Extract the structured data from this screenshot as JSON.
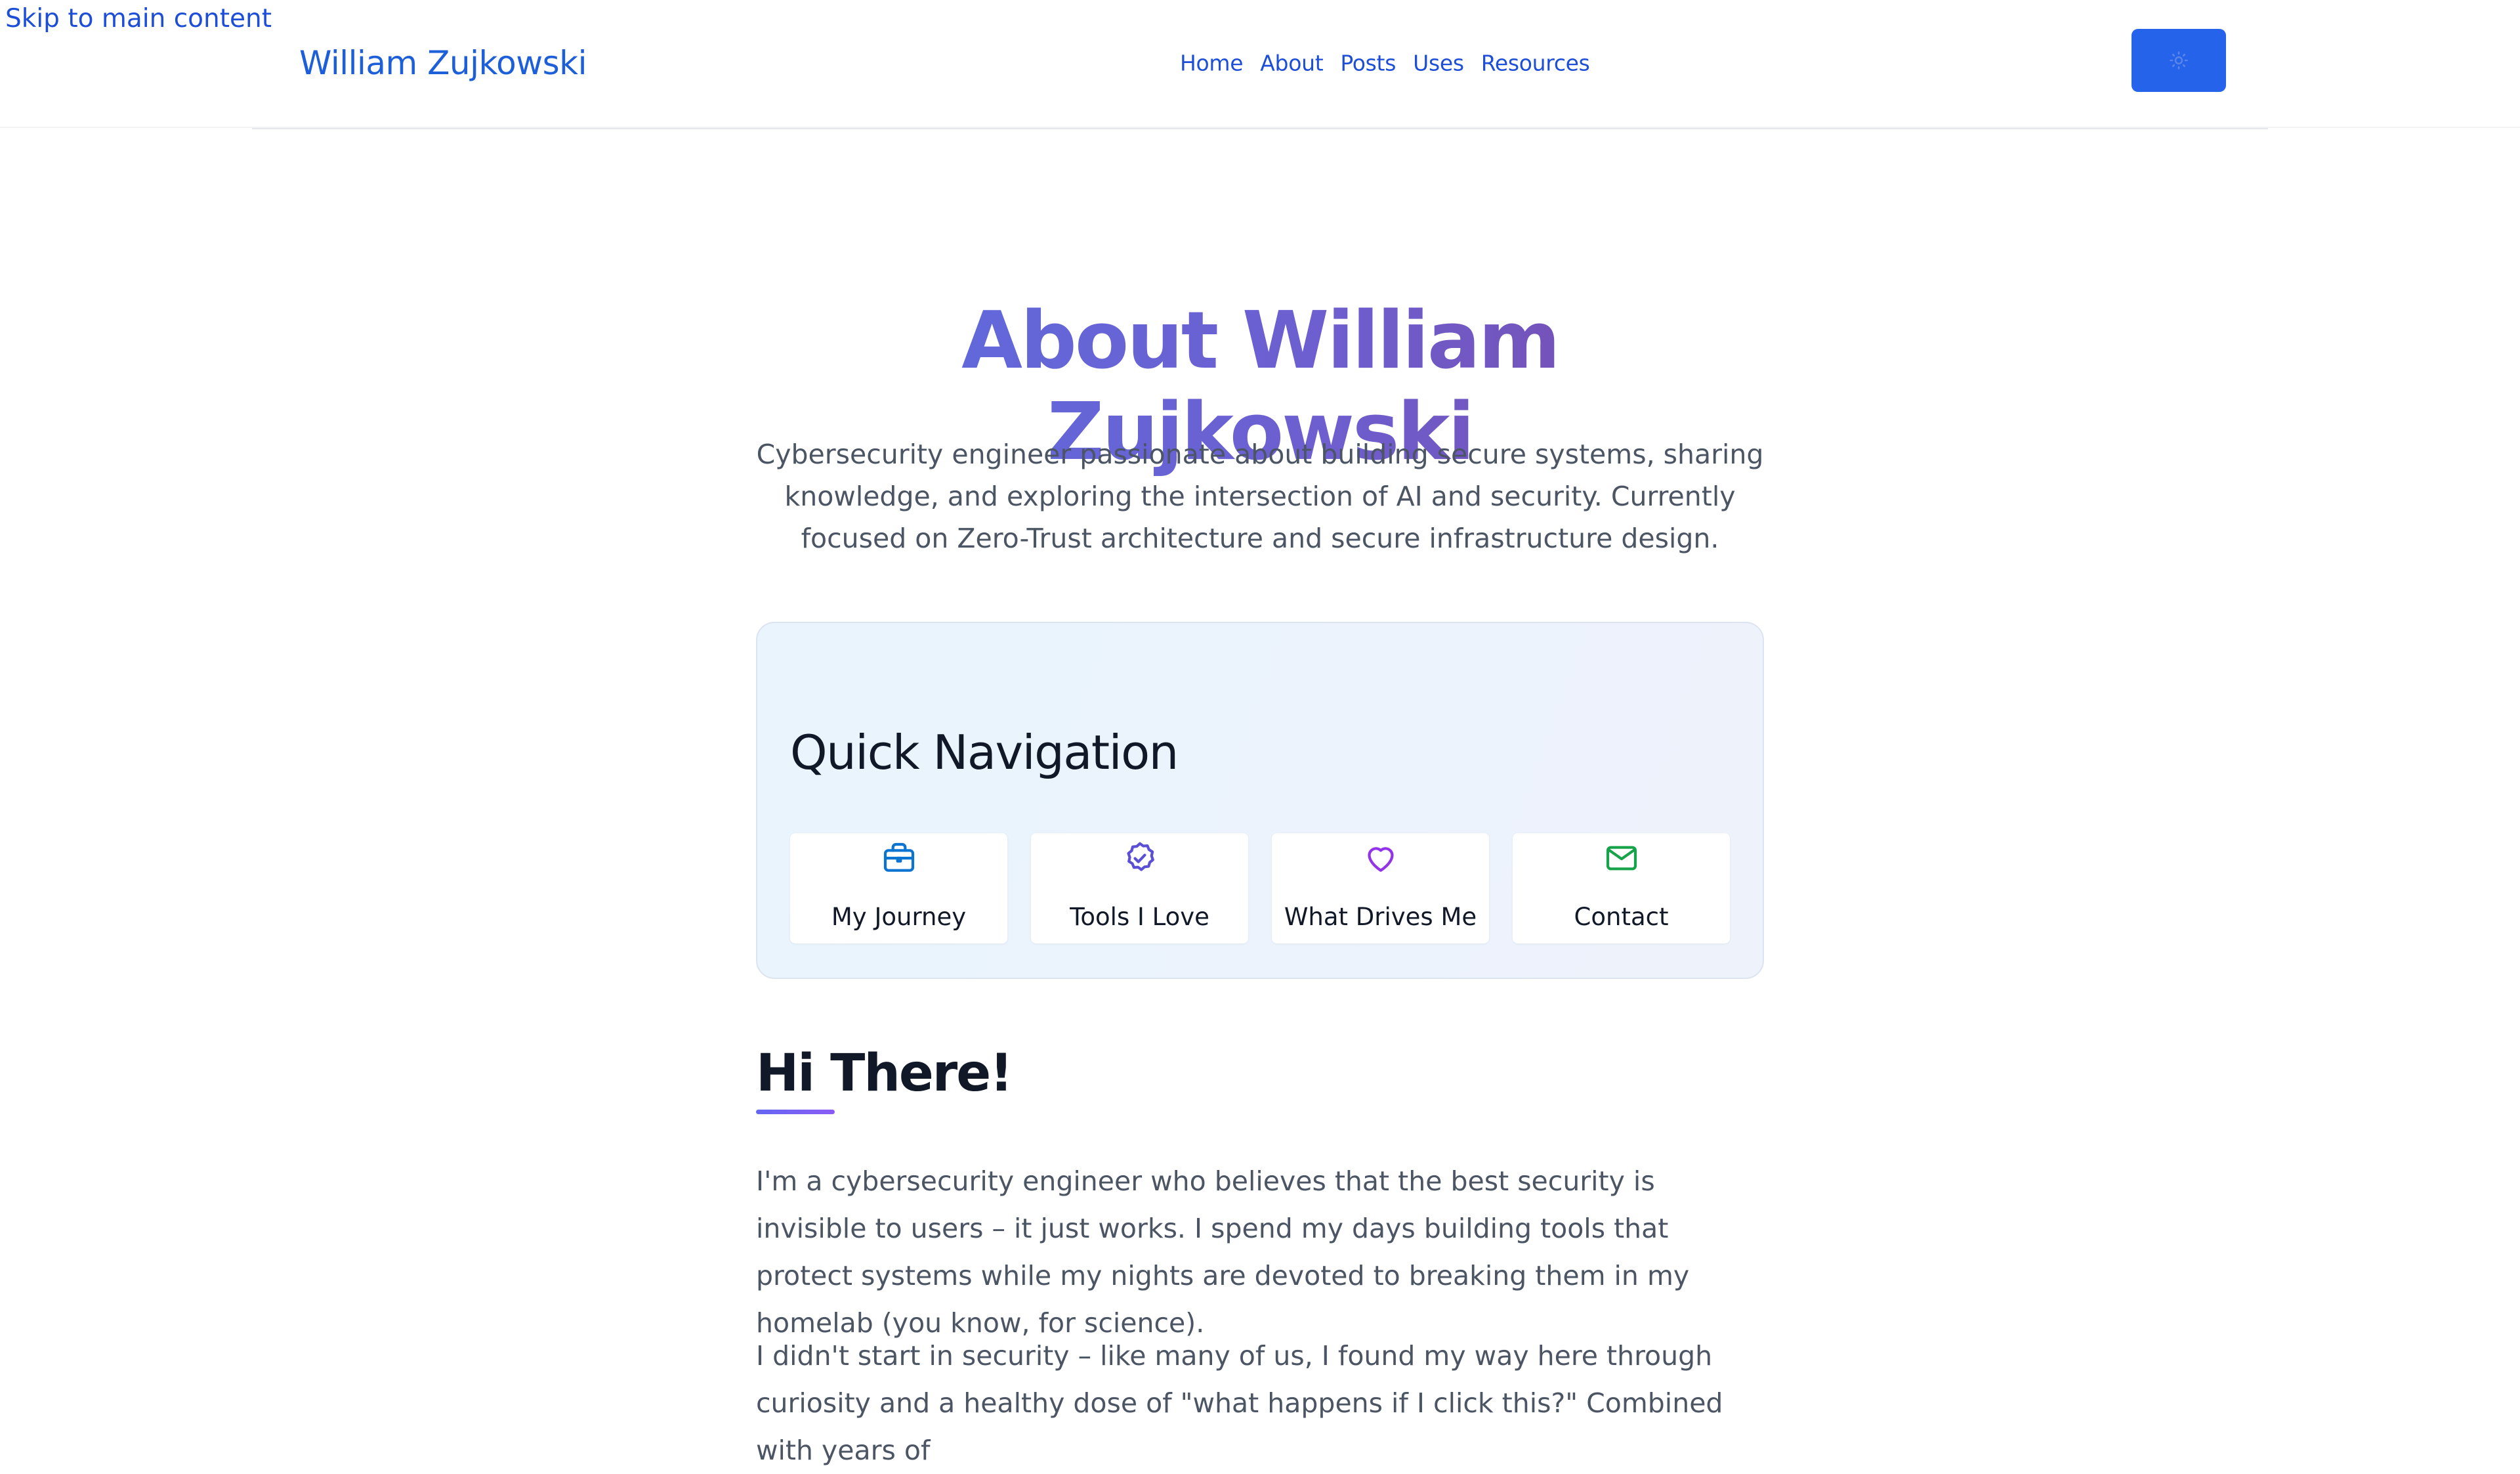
{
  "skip_link": "Skip to main content",
  "header": {
    "brand": "William Zujkowski",
    "nav": [
      "Home",
      "About",
      "Posts",
      "Uses",
      "Resources"
    ],
    "theme_toggle_icon": "sun-icon",
    "accent_color": "#2563eb"
  },
  "page": {
    "title": "About William Zujkowski",
    "intro": "Cybersecurity engineer passionate about building secure systems, sharing knowledge, and exploring the intersection of AI and security. Currently focused on Zero-Trust architecture and secure infrastructure design."
  },
  "quick_nav": {
    "title": "Quick Navigation",
    "items": [
      {
        "label": "My Journey",
        "icon": "briefcase-icon",
        "color": "#0b74d1"
      },
      {
        "label": "Tools I Love",
        "icon": "badge-check-icon",
        "color": "#5b4fd6"
      },
      {
        "label": "What Drives Me",
        "icon": "heart-icon",
        "color": "#9333ea"
      },
      {
        "label": "Contact",
        "icon": "mail-icon",
        "color": "#16a34a"
      }
    ]
  },
  "section": {
    "title": "Hi There!",
    "paragraphs": [
      "I'm a cybersecurity engineer who believes that the best security is invisible to users – it just works. I spend my days building tools that protect systems while my nights are devoted to breaking them in my homelab (you know, for science).",
      "I didn't start in security – like many of us, I found my way here through curiosity and a healthy dose of \"what happens if I click this?\" Combined with years of"
    ]
  }
}
